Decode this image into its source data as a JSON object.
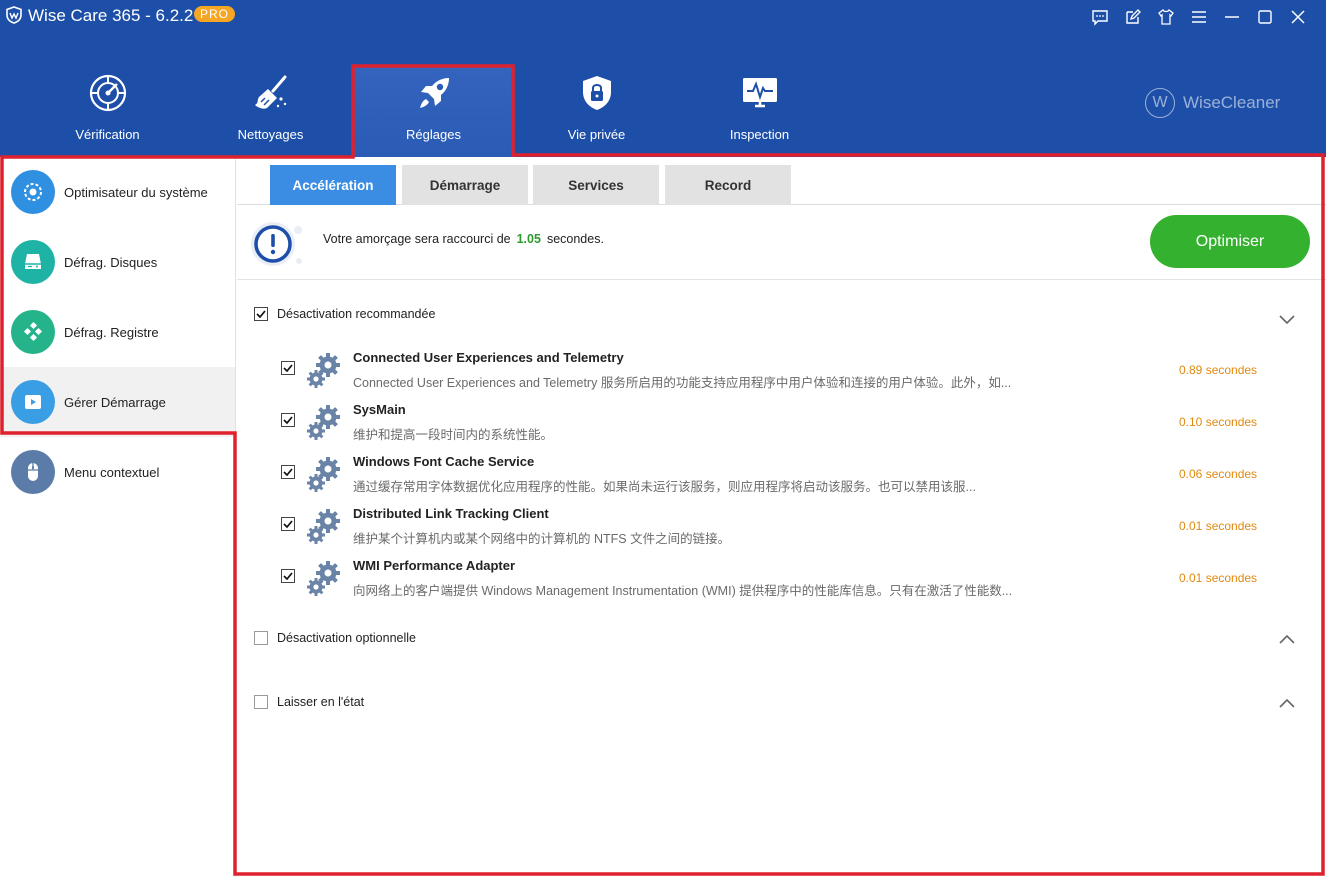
{
  "titlebar": {
    "app_title": "Wise Care 365 - 6.2.2",
    "badge": "PRO",
    "controls": [
      "feedback-icon",
      "edit-icon",
      "skin-icon",
      "menu-icon",
      "minimize-icon",
      "maximize-icon",
      "close-icon"
    ]
  },
  "nav": {
    "items": [
      {
        "label": "Vérification",
        "icon": "radar-icon"
      },
      {
        "label": "Nettoyages",
        "icon": "broom-icon"
      },
      {
        "label": "Réglages",
        "icon": "rocket-icon",
        "active": true
      },
      {
        "label": "Vie privée",
        "icon": "shield-lock-icon"
      },
      {
        "label": "Inspection",
        "icon": "monitor-pulse-icon"
      }
    ],
    "brand": "WiseCleaner",
    "brand_mark": "W"
  },
  "sidebar": {
    "items": [
      {
        "label": "Optimisateur du système",
        "icon": "gear-optimizer-icon",
        "color": "#2f8fe0"
      },
      {
        "label": "Défrag. Disques",
        "icon": "disk-icon",
        "color": "#1fb3a6"
      },
      {
        "label": "Défrag. Registre",
        "icon": "registry-icon",
        "color": "#24b38a"
      },
      {
        "label": "Gérer Démarrage",
        "icon": "play-window-icon",
        "color": "#3a9ee4",
        "active": true
      },
      {
        "label": "Menu contextuel",
        "icon": "mouse-icon",
        "color": "#5b7ca8"
      }
    ]
  },
  "tabs": [
    {
      "label": "Accélération",
      "active": true
    },
    {
      "label": "Démarrage"
    },
    {
      "label": "Services"
    },
    {
      "label": "Record"
    }
  ],
  "info": {
    "text_before": "Votre amorçage sera raccourci de",
    "value": "1.05",
    "text_after": "secondes.",
    "button": "Optimiser"
  },
  "groups": {
    "recommended": {
      "label": "Désactivation recommandée",
      "checked": true,
      "expanded": true
    },
    "optional": {
      "label": "Désactivation optionnelle",
      "checked": false,
      "expanded": false
    },
    "leave": {
      "label": "Laisser en l'état",
      "checked": false,
      "expanded": false
    }
  },
  "services": [
    {
      "name": "Connected User Experiences and Telemetry",
      "desc": "Connected User Experiences and Telemetry 服务所启用的功能支持应用程序中用户体验和连接的用户体验。此外，如...",
      "time": "0.89 secondes",
      "checked": true
    },
    {
      "name": "SysMain",
      "desc": "维护和提高一段时间内的系统性能。",
      "time": "0.10 secondes",
      "checked": true
    },
    {
      "name": "Windows Font Cache Service",
      "desc": "通过缓存常用字体数据优化应用程序的性能。如果尚未运行该服务，则应用程序将启动该服务。也可以禁用该服...",
      "time": "0.06 secondes",
      "checked": true
    },
    {
      "name": "Distributed Link Tracking Client",
      "desc": "维护某个计算机内或某个网络中的计算机的 NTFS 文件之间的链接。",
      "time": "0.01 secondes",
      "checked": true
    },
    {
      "name": "WMI Performance Adapter",
      "desc": "向网络上的客户端提供 Windows Management Instrumentation (WMI) 提供程序中的性能库信息。只有在激活了性能数...",
      "time": "0.01 secondes",
      "checked": true
    }
  ],
  "colors": {
    "header": "#1e4fa8",
    "active_tab": "#3a8de3",
    "optimize_button": "#34b12f",
    "time_text": "#e08a10",
    "value_text": "#2e9a2e",
    "annotation": "#e0202c"
  }
}
